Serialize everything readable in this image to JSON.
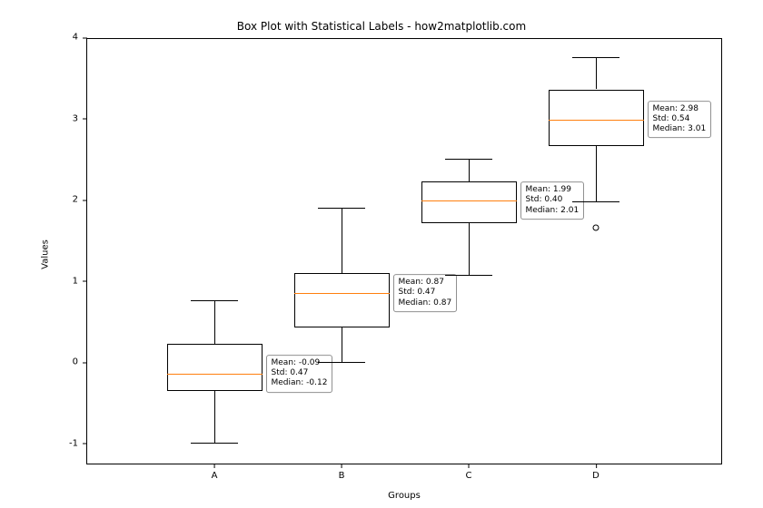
{
  "chart_data": {
    "type": "box",
    "title": "Box Plot with Statistical Labels - how2matplotlib.com",
    "xlabel": "Groups",
    "ylabel": "Values",
    "ylim": [
      -1.25,
      4.0
    ],
    "yticks": [
      -1,
      0,
      1,
      2,
      3,
      4
    ],
    "categories": [
      "A",
      "B",
      "C",
      "D"
    ],
    "series": [
      {
        "name": "A",
        "q1": -0.33,
        "median": -0.12,
        "q3": 0.25,
        "whisker_low": -0.97,
        "whisker_high": 0.78,
        "outliers": [],
        "mean": -0.09,
        "std": 0.47
      },
      {
        "name": "B",
        "q1": 0.45,
        "median": 0.87,
        "q3": 1.12,
        "whisker_low": 0.02,
        "whisker_high": 1.92,
        "outliers": [],
        "mean": 0.87,
        "std": 0.47
      },
      {
        "name": "C",
        "q1": 1.73,
        "median": 2.01,
        "q3": 2.25,
        "whisker_low": 1.1,
        "whisker_high": 2.52,
        "outliers": [],
        "mean": 1.99,
        "std": 0.4
      },
      {
        "name": "D",
        "q1": 2.68,
        "median": 3.01,
        "q3": 3.38,
        "whisker_low": 2.0,
        "whisker_high": 3.78,
        "outliers": [
          1.68
        ],
        "mean": 2.98,
        "std": 0.54
      }
    ],
    "stat_labels": [
      {
        "mean_text": "Mean: -0.09",
        "std_text": "Std: 0.47",
        "median_text": "Median: -0.12"
      },
      {
        "mean_text": "Mean: 0.87",
        "std_text": "Std: 0.47",
        "median_text": "Median: 0.87"
      },
      {
        "mean_text": "Mean: 1.99",
        "std_text": "Std: 0.40",
        "median_text": "Median: 2.01"
      },
      {
        "mean_text": "Mean: 2.98",
        "std_text": "Std: 0.54",
        "median_text": "Median: 3.01"
      }
    ]
  }
}
